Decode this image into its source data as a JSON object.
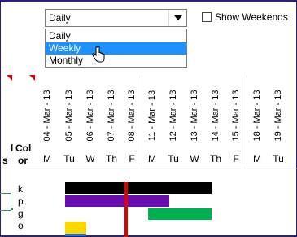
{
  "view_select": {
    "value": "Daily",
    "options": [
      "Daily",
      "Weekly",
      "Monthly"
    ],
    "highlighted": "Weekly"
  },
  "show_weekends": {
    "label": "Show Weekends",
    "checked": false
  },
  "columns": {
    "left_partial": "s",
    "color_line1": "Col",
    "color_line2": "or",
    "left_top_partial": "l"
  },
  "dates": [
    {
      "date": "04 - Mar - 13",
      "day": "M"
    },
    {
      "date": "05 - Mar - 13",
      "day": "Tu"
    },
    {
      "date": "06 - Mar - 13",
      "day": "W"
    },
    {
      "date": "07 - Mar - 13",
      "day": "Th"
    },
    {
      "date": "08 - Mar - 13",
      "day": "F"
    },
    {
      "date": "11 - Mar - 13",
      "day": "M"
    },
    {
      "date": "12 - Mar - 13",
      "day": "Tu"
    },
    {
      "date": "13 - Mar - 13",
      "day": "W"
    },
    {
      "date": "14 - Mar - 13",
      "day": "Th"
    },
    {
      "date": "15 - Mar - 13",
      "day": "F"
    },
    {
      "date": "18 - Mar - 13",
      "day": "M"
    },
    {
      "date": "19 - Mar - 13",
      "day": "Tu"
    }
  ],
  "color_codes": [
    "k",
    "p",
    "g",
    "o"
  ],
  "colors": {
    "black": "#000000",
    "purple": "#6a0dad",
    "green": "#00b050",
    "yellow": "#ffd700",
    "blue": "#1e6fd9",
    "today_line": "#e00000",
    "highlight": "#1e90ff"
  }
}
